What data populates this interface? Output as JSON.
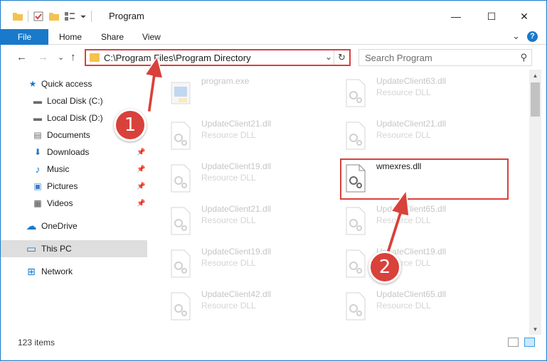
{
  "window": {
    "title": "Program",
    "controls": {
      "minimize": "—",
      "maximize": "☐",
      "close": "✕"
    }
  },
  "ribbon": {
    "file": "File",
    "tabs": [
      "Home",
      "Share",
      "View"
    ],
    "expand_glyph": "⌄",
    "help_glyph": "?"
  },
  "address": {
    "path": "C:\\Program Files\\Program Directory",
    "dropdown_glyph": "⌄",
    "refresh_glyph": "↻"
  },
  "nav_buttons": {
    "back": "←",
    "forward": "→",
    "recent": "⌄",
    "up": "↑"
  },
  "search": {
    "placeholder": "Search Program",
    "icon_glyph": "⚲"
  },
  "nav_pane": {
    "items": [
      {
        "label": "Quick access",
        "icon": "star-icon",
        "glyph": "★",
        "color": "#1979ca"
      },
      {
        "label": "Local Disk (C:)",
        "icon": "drive-icon",
        "glyph": "▬",
        "color": "#6a6a6a"
      },
      {
        "label": "Local Disk (D:)",
        "icon": "drive-icon",
        "glyph": "▬",
        "color": "#6a6a6a"
      },
      {
        "label": "Documents",
        "icon": "documents-icon",
        "glyph": "▤",
        "color": "#6a6a6a"
      },
      {
        "label": "Downloads",
        "icon": "downloads-icon",
        "glyph": "⬇",
        "color": "#1979ca"
      },
      {
        "label": "Music",
        "icon": "music-icon",
        "glyph": "♪",
        "color": "#1979ca"
      },
      {
        "label": "Pictures",
        "icon": "pictures-icon",
        "glyph": "▣",
        "color": "#3b7fc4"
      },
      {
        "label": "Videos",
        "icon": "videos-icon",
        "glyph": "▦",
        "color": "#444444"
      },
      {
        "label": "OneDrive",
        "icon": "cloud-icon",
        "glyph": "☁",
        "color": "#1979ca"
      },
      {
        "label": "This PC",
        "icon": "computer-icon",
        "glyph": "▭",
        "color": "#1979ca"
      },
      {
        "label": "Network",
        "icon": "network-icon",
        "glyph": "⊞",
        "color": "#1979ca"
      }
    ],
    "pin_glyph": "📌"
  },
  "files": [
    {
      "name": "program.exe",
      "type": ""
    },
    {
      "name": "UpdateClient63.dll",
      "type": "Resource DLL"
    },
    {
      "name": "UpdateClient21.dll",
      "type": "Resource DLL"
    },
    {
      "name": "UpdateClient21.dll",
      "type": "Resource DLL"
    },
    {
      "name": "UpdateClient19.dll",
      "type": "Resource DLL"
    },
    {
      "name": "wmexres.dll",
      "type": ""
    },
    {
      "name": "UpdateClient21.dll",
      "type": "Resource DLL"
    },
    {
      "name": "UpdateClient65.dll",
      "type": "Resource DLL"
    },
    {
      "name": "UpdateClient19.dll",
      "type": "Resource DLL"
    },
    {
      "name": "UpdateClient19.dll",
      "type": "Resource DLL"
    },
    {
      "name": "UpdateClient42.dll",
      "type": "Resource DLL"
    },
    {
      "name": "UpdateClient65.dll",
      "type": "Resource DLL"
    }
  ],
  "status": {
    "item_count": "123 items"
  },
  "callouts": {
    "one": "1",
    "two": "2"
  },
  "colors": {
    "accent": "#1979ca",
    "highlight": "#d9413b"
  }
}
